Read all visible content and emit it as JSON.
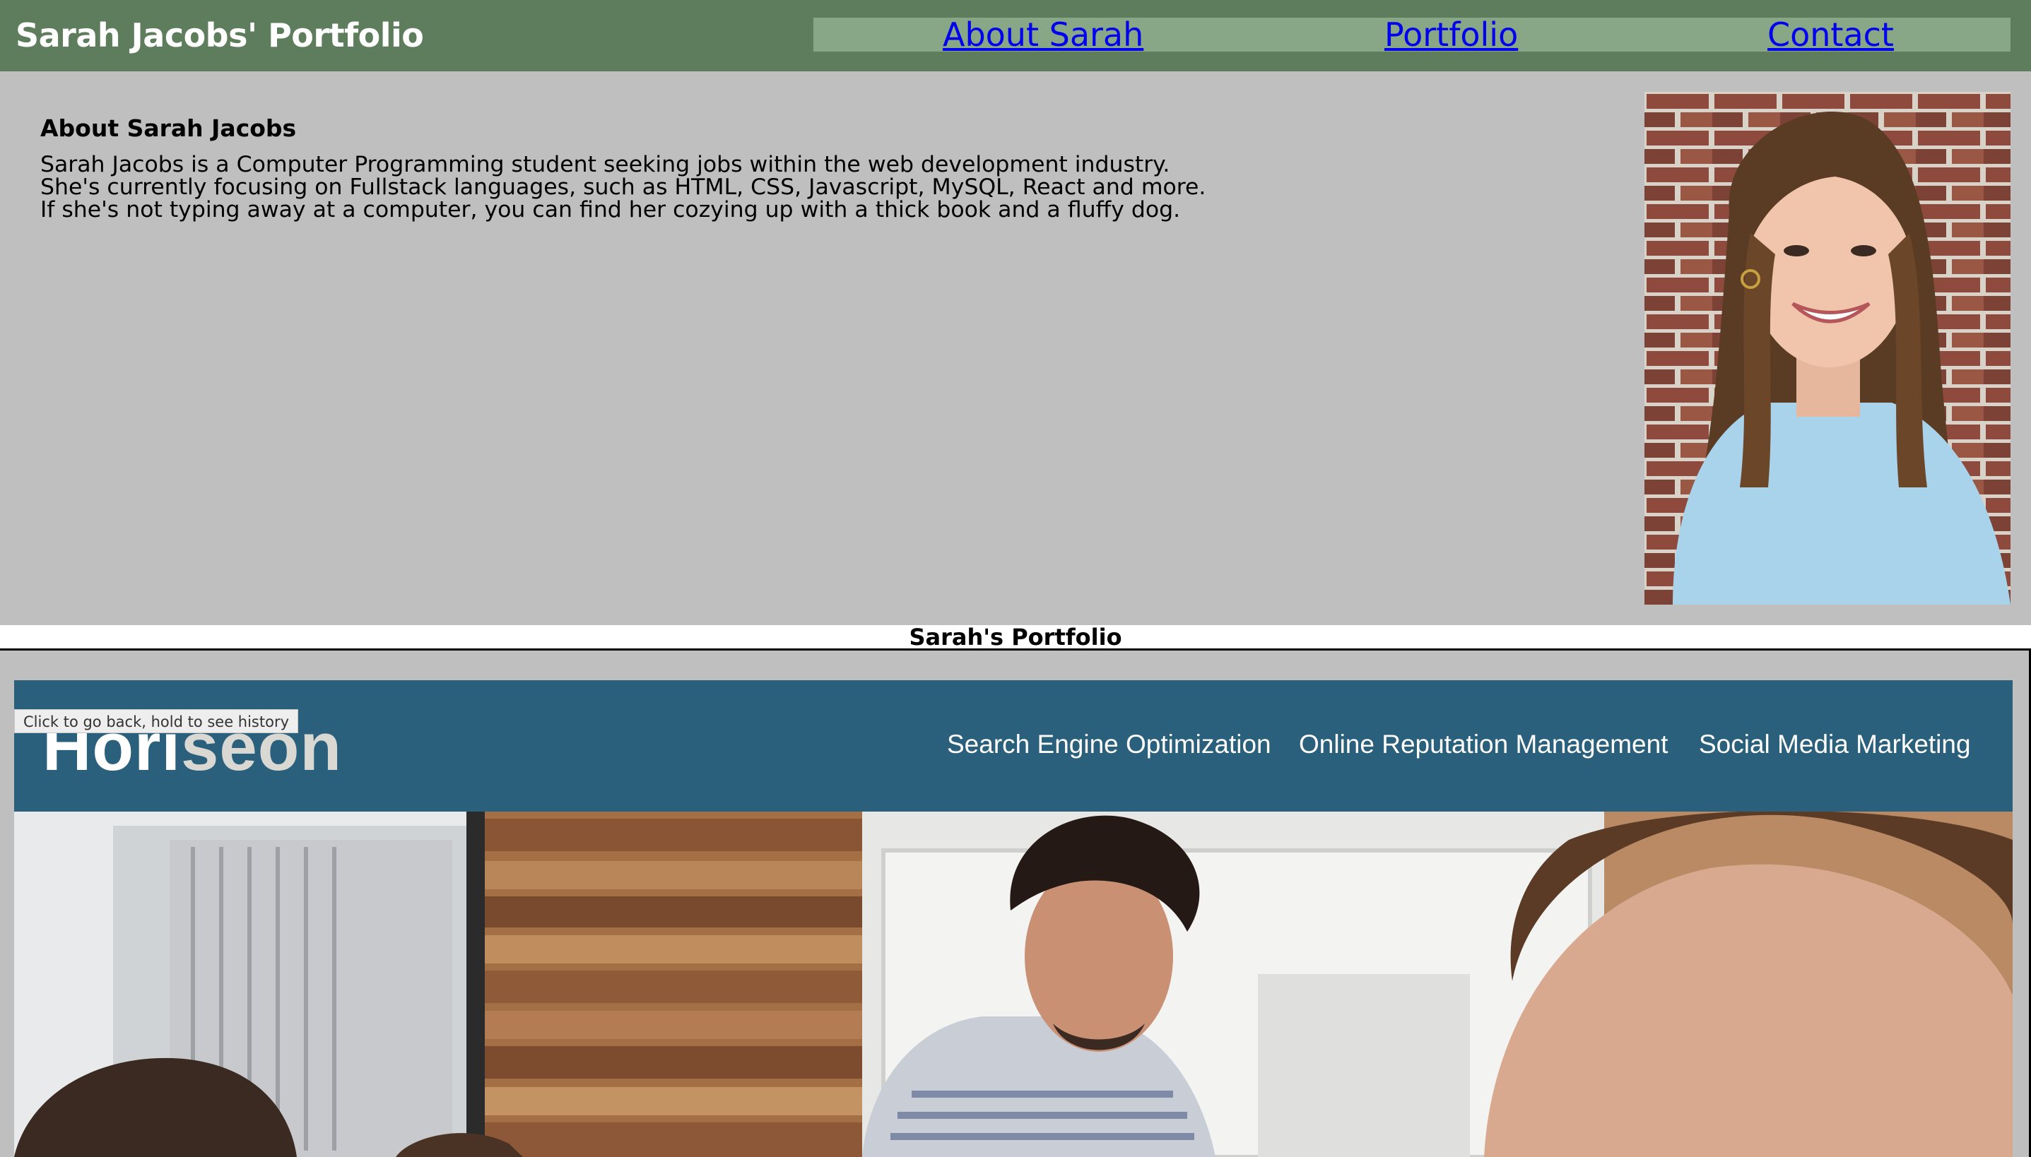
{
  "header": {
    "site_title": "Sarah Jacobs' Portfolio",
    "nav": [
      {
        "label": "About Sarah"
      },
      {
        "label": "Portfolio"
      },
      {
        "label": "Contact"
      }
    ]
  },
  "about": {
    "heading": "About Sarah Jacobs",
    "body": "Sarah Jacobs is a Computer Programming student seeking jobs within the web development industry. She's currently focusing on Fullstack languages, such as HTML, CSS, Javascript, MySQL, React and more. If she's not typing away at a computer, you can find her cozying up with a thick book and a fluffy dog.",
    "photo_alt": "Photo of Sarah Jacobs"
  },
  "portfolio": {
    "heading": "Sarah's Portfolio"
  },
  "project": {
    "logo_part1": "Hori",
    "logo_part2": "seon",
    "nav": [
      {
        "label": "Search Engine Optimization"
      },
      {
        "label": "Online Reputation Management"
      },
      {
        "label": "Social Media Marketing"
      }
    ]
  },
  "tooltip": {
    "text": "Click to go back, hold to see history"
  },
  "colors": {
    "header_bg": "#5e7d5c",
    "nav_bg": "#87a786",
    "page_bg": "#bfbfbf",
    "link": "#0000ee",
    "project_header_bg": "#2a607c"
  }
}
